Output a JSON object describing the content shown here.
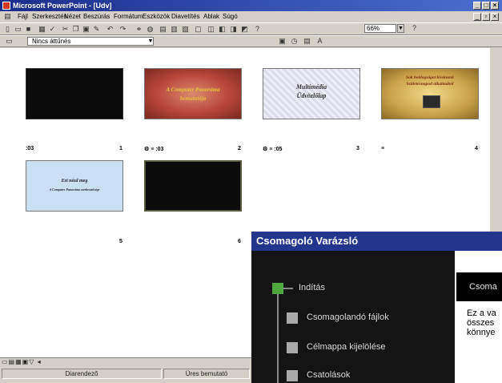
{
  "window": {
    "title": "Microsoft PowerPoint - [Udv]"
  },
  "menubar": {
    "items": [
      "Fájl",
      "Szerkesztés",
      "Nézet",
      "Beszúrás",
      "Formátum",
      "Eszközök",
      "Diavetítés",
      "Ablak",
      "Súgó"
    ]
  },
  "toolbar": {
    "zoom_value": "66%"
  },
  "transition": {
    "selected": "Nincs áttűnés"
  },
  "slides": [
    {
      "number": "1",
      "timing": ":03",
      "title": "",
      "subtitle": ""
    },
    {
      "number": "2",
      "timing": ":03",
      "title": "A Computer Panoráma",
      "subtitle": "bemutatója"
    },
    {
      "number": "3",
      "timing": ":05",
      "title": "Multimédia",
      "subtitle": "Üdvözlőlap"
    },
    {
      "number": "4",
      "timing": "",
      "title": "Sok boldogságot kívánunk",
      "subtitle": "Születésnapod alkalmából"
    },
    {
      "number": "5",
      "timing": "",
      "title": "Ezt nézd meg",
      "subtitle": "A Computer Panoráma szerkesztősége"
    },
    {
      "number": "6",
      "timing": "",
      "title": "",
      "subtitle": ""
    }
  ],
  "statusbar": {
    "view_label": "Diarendező",
    "template_label": "Üres bemutató"
  },
  "wizard": {
    "title": "Csomagoló Varázsló",
    "steps": [
      "Indítás",
      "Csomagolandó fájlok",
      "Célmappa kijelölése",
      "Csatolások"
    ],
    "active_step": 0,
    "content_heading": "Csoma",
    "content_lines": [
      "Ez a va",
      "összes",
      "könnye"
    ]
  },
  "colors": {
    "title_bar": "#1a2d8c",
    "wizard_title_bar": "#22368e",
    "wizard_active_step": "#4fa83d",
    "slide_2_background": "#b8453a",
    "slide_4_background": "#c9a24a",
    "slide_5_background": "#c9dff2"
  }
}
